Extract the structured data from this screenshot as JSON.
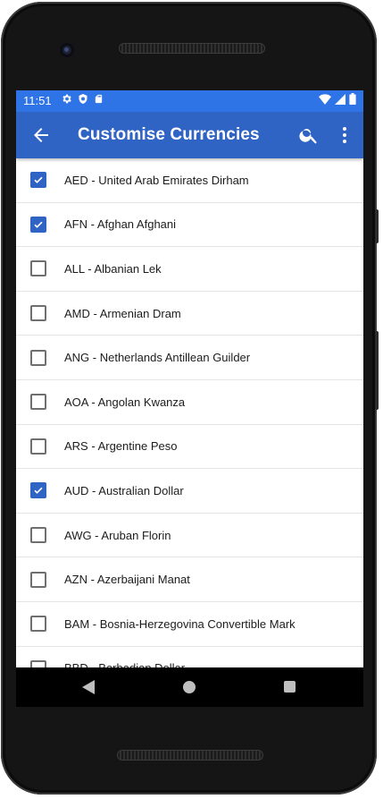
{
  "status_bar": {
    "time": "11:51",
    "left_icons": [
      "gear-icon",
      "shield-icon",
      "sd-card-icon"
    ],
    "right_icons": [
      "wifi-icon",
      "signal-icon",
      "battery-icon"
    ],
    "color": "#2f74e6"
  },
  "app_bar": {
    "title": "Customise Currencies",
    "back_icon": "arrow-back-icon",
    "search_icon": "search-icon",
    "more_icon": "more-vert-icon",
    "color": "#2f63c4"
  },
  "currencies": [
    {
      "label": "AED - United Arab Emirates Dirham",
      "checked": true
    },
    {
      "label": "AFN - Afghan Afghani",
      "checked": true
    },
    {
      "label": "ALL - Albanian Lek",
      "checked": false
    },
    {
      "label": "AMD - Armenian Dram",
      "checked": false
    },
    {
      "label": "ANG - Netherlands Antillean Guilder",
      "checked": false
    },
    {
      "label": "AOA - Angolan Kwanza",
      "checked": false
    },
    {
      "label": "ARS - Argentine Peso",
      "checked": false
    },
    {
      "label": "AUD - Australian Dollar",
      "checked": true
    },
    {
      "label": "AWG - Aruban Florin",
      "checked": false
    },
    {
      "label": "AZN - Azerbaijani Manat",
      "checked": false
    },
    {
      "label": "BAM - Bosnia-Herzegovina Convertible Mark",
      "checked": false
    },
    {
      "label": "BBD - Barbadian Dollar",
      "checked": false
    }
  ],
  "nav_bar": {
    "back_icon": "nav-back-icon",
    "home_icon": "nav-home-icon",
    "recents_icon": "nav-recents-icon"
  },
  "colors": {
    "checkbox_checked": "#2f63c4",
    "checkbox_unchecked": "#6f6f6f"
  }
}
